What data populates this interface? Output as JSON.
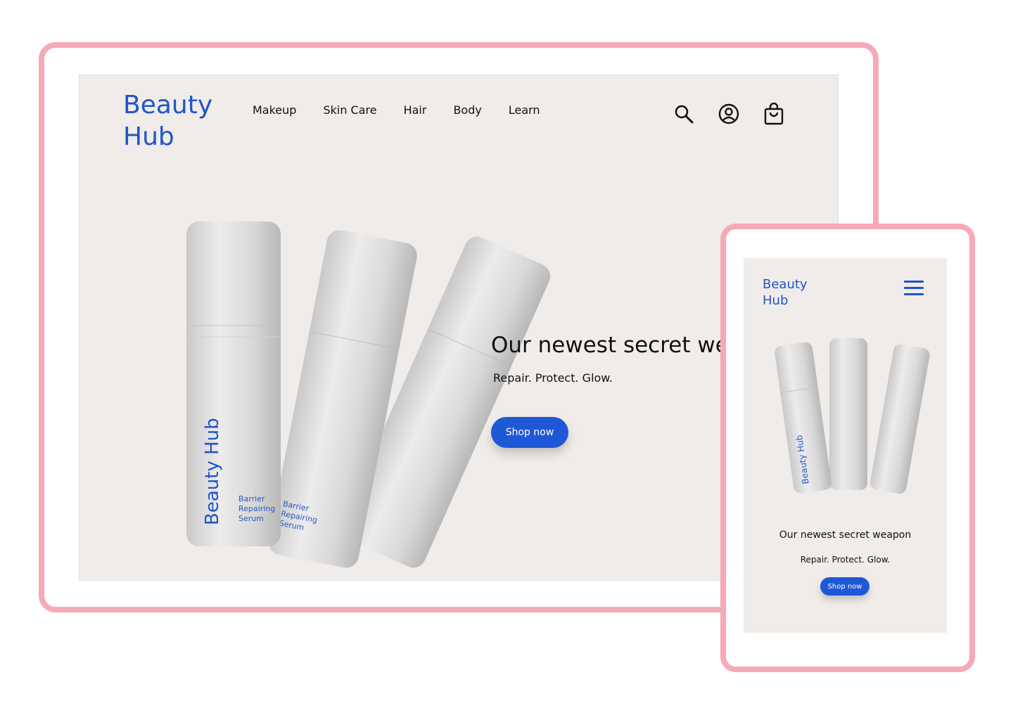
{
  "desktop": {
    "logo": "Beauty Hub",
    "nav": [
      "Makeup",
      "Skin Care",
      "Hair",
      "Body",
      "Learn"
    ],
    "icons": [
      "search-icon",
      "account-icon",
      "shopping-bag-icon"
    ],
    "hero": {
      "title": "Our newest secret weapon",
      "subtitle": "Repair. Protect. Glow.",
      "cta": "Shop now"
    },
    "product": {
      "brand": "Beauty Hub",
      "label_line1": "Barrier",
      "label_line2": "Repairing",
      "label_line3": "Serum"
    }
  },
  "mobile": {
    "logo": "Beauty Hub",
    "hero": {
      "title": "Our newest secret weapon",
      "subtitle": "Repair. Protect. Glow.",
      "cta": "Shop now"
    }
  },
  "colors": {
    "frame": "#f6a9b6",
    "accent": "#1f58d6",
    "brand_text": "#1f55c8",
    "background": "#efecea"
  }
}
